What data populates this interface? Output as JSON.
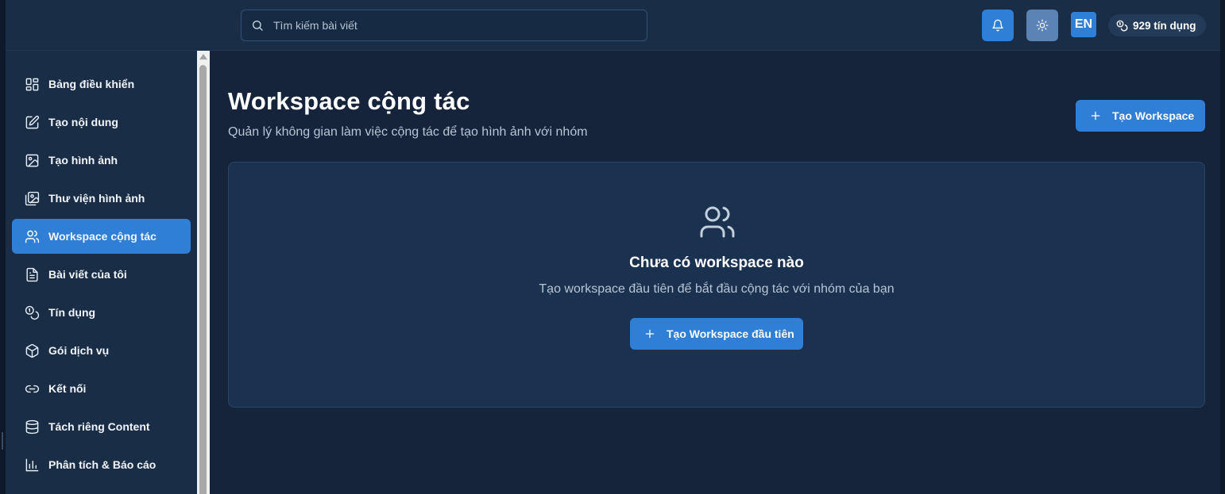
{
  "header": {
    "search_placeholder": "Tìm kiếm bài viết",
    "language": "EN",
    "credits_label": "929 tín dụng"
  },
  "sidebar": {
    "items": [
      {
        "label": "Bảng điều khiển",
        "icon": "dashboard-icon",
        "active": false
      },
      {
        "label": "Tạo nội dung",
        "icon": "edit-icon",
        "active": false
      },
      {
        "label": "Tạo hình ảnh",
        "icon": "image-icon",
        "active": false
      },
      {
        "label": "Thư viện hình ảnh",
        "icon": "gallery-icon",
        "active": false
      },
      {
        "label": "Workspace cộng tác",
        "icon": "users-icon",
        "active": true
      },
      {
        "label": "Bài viết của tôi",
        "icon": "file-text-icon",
        "active": false
      },
      {
        "label": "Tín dụng",
        "icon": "coins-icon",
        "active": false
      },
      {
        "label": "Gói dịch vụ",
        "icon": "package-icon",
        "active": false
      },
      {
        "label": "Kết nối",
        "icon": "link-icon",
        "active": false
      },
      {
        "label": "Tách riêng Content",
        "icon": "database-icon",
        "active": false
      },
      {
        "label": "Phân tích & Báo cáo",
        "icon": "bar-chart-icon",
        "active": false
      }
    ]
  },
  "main": {
    "title": "Workspace cộng tác",
    "subtitle": "Quản lý không gian làm việc cộng tác để tạo hình ảnh với nhóm",
    "create_button": "Tạo Workspace",
    "empty_state": {
      "title": "Chưa có workspace nào",
      "text": "Tạo workspace đầu tiên để bắt đầu cộng tác với nhóm của bạn",
      "button": "Tạo Workspace đầu tiên"
    }
  },
  "colors": {
    "accent": "#2f7fd6",
    "background": "#15243a",
    "sidebar": "#1a2d47",
    "card": "#1b3150"
  }
}
